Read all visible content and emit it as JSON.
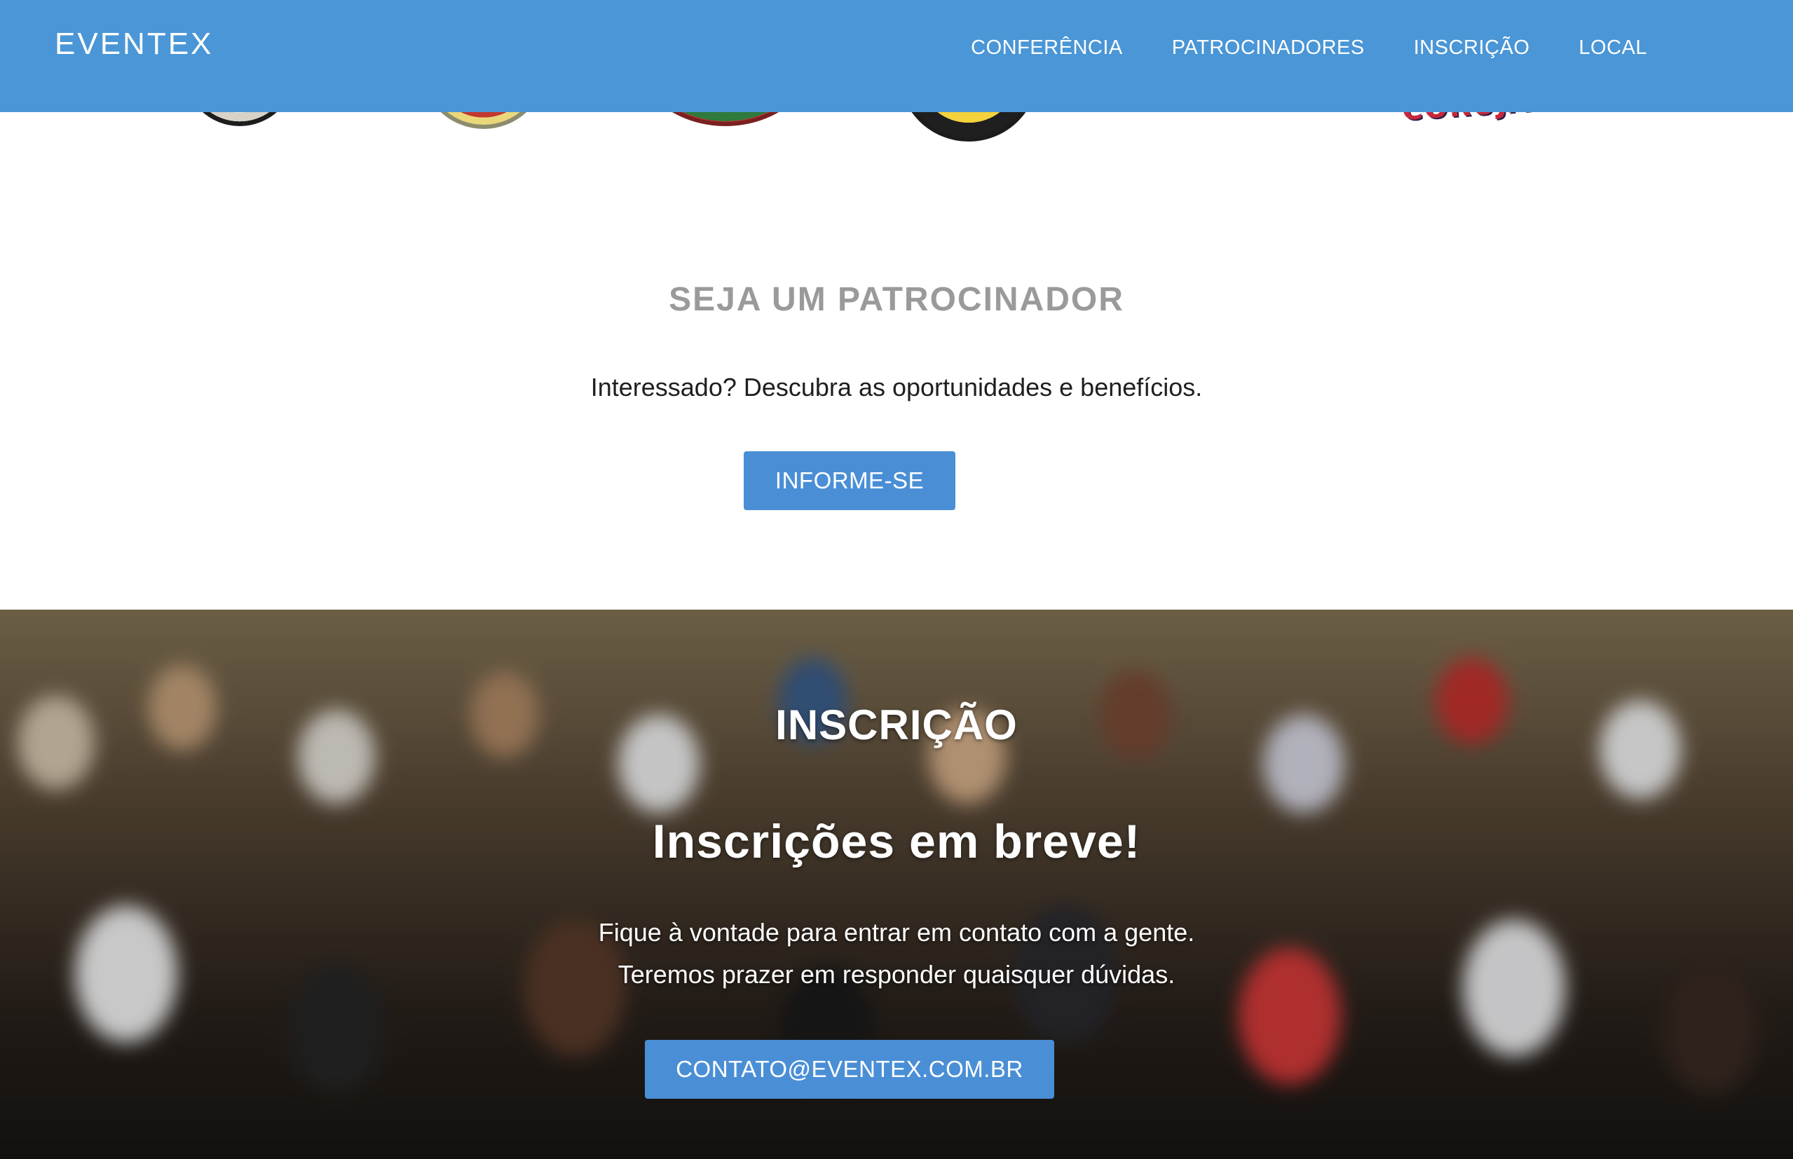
{
  "header": {
    "brand": "EVENTEX",
    "nav": [
      {
        "label": "CONFERÊNCIA"
      },
      {
        "label": "PATROCINADORES"
      },
      {
        "label": "INSCRIÇÃO"
      },
      {
        "label": "LOCAL"
      }
    ],
    "background_color": "#4a96d6"
  },
  "sponsors": {
    "logos": [
      {
        "name": "sponsor-logo-1"
      },
      {
        "name": "sponsor-logo-2"
      },
      {
        "name": "sponsor-logo-3"
      },
      {
        "name": "sponsor-logo-4"
      },
      {
        "name": "sponsor-logo-5",
        "text": "CORUJA"
      }
    ],
    "title": "SEJA UM PATROCINADOR",
    "text": "Interessado? Descubra as oportunidades e benefícios.",
    "button_label": "INFORME-SE"
  },
  "registration": {
    "title": "INSCRIÇÃO",
    "subtitle": "Inscrições em breve!",
    "text_line_1": "Fique à vontade para entrar em contato com a gente.",
    "text_line_2": "Teremos prazer em responder quaisquer dúvidas.",
    "button_label": "CONTATO@EVENTEX.COM.BR"
  },
  "colors": {
    "accent": "#4a8fd6",
    "heading_gray": "#9a9a9a",
    "text_dark": "#1f1f1f"
  }
}
